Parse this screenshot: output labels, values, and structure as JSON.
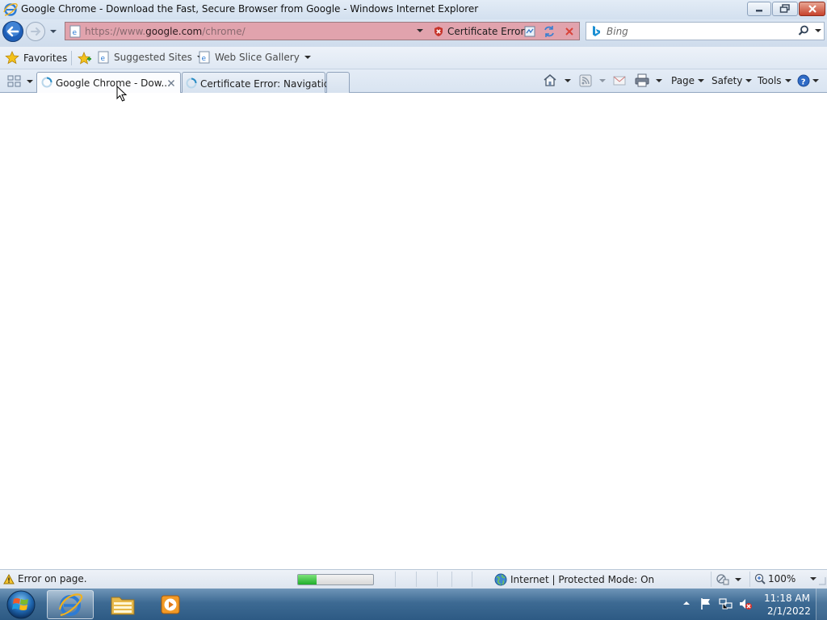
{
  "window": {
    "title": "Google Chrome - Download the Fast, Secure Browser from Google - Windows Internet Explorer"
  },
  "nav": {
    "address_prefix": "https://www.",
    "address_host": "google.com",
    "address_path": "/chrome/",
    "certificate_error": "Certificate Error",
    "search_placeholder": "Bing"
  },
  "favorites_bar": {
    "favorites_label": "Favorites",
    "items": [
      {
        "label": "Suggested Sites"
      },
      {
        "label": "Web Slice Gallery"
      }
    ]
  },
  "tabs": [
    {
      "label": "Google Chrome - Dow...",
      "active": true
    },
    {
      "label": "Certificate Error: Navigatio...",
      "active": false
    }
  ],
  "command_bar": {
    "page": "Page",
    "safety": "Safety",
    "tools": "Tools"
  },
  "status": {
    "message": "Error on page.",
    "progress": 0.25,
    "zone": "Internet | Protected Mode: On",
    "zoom": "100%"
  },
  "taskbar": {
    "time": "11:18 AM",
    "date": "2/1/2022"
  },
  "colors": {
    "address_error": "#e1a3ad",
    "taskbar": "#3d6a93",
    "progress": "#1fae2a"
  }
}
